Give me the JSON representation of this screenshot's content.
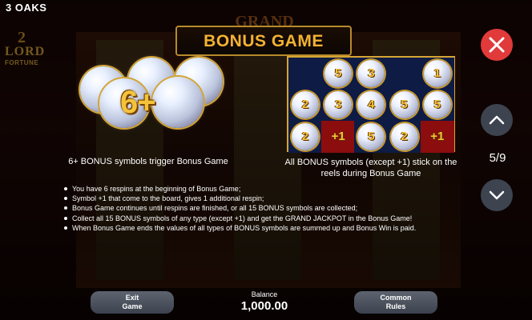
{
  "brand": "3 OAKS",
  "background": {
    "grand_label": "GRAND",
    "logo": {
      "number": "2",
      "line1": "LORD",
      "line2": "FORTUNE"
    }
  },
  "title": "BONUS GAME",
  "left_panel": {
    "badge": "6+",
    "caption": "6+ BONUS symbols trigger Bonus Game"
  },
  "right_panel": {
    "caption": "All BONUS symbols (except +1) stick on the reels during Bonus Game",
    "grid_rows": [
      [
        {
          "t": "blue",
          "v": ""
        },
        {
          "t": "pearl",
          "v": "5"
        },
        {
          "t": "pearl",
          "v": "3"
        },
        {
          "t": "blue",
          "v": ""
        },
        {
          "t": "pearl",
          "v": "1"
        }
      ],
      [
        {
          "t": "pearl",
          "v": "2"
        },
        {
          "t": "pearl",
          "v": "3"
        },
        {
          "t": "pearl",
          "v": "4"
        },
        {
          "t": "pearl",
          "v": "5"
        },
        {
          "t": "pearl",
          "v": "5"
        }
      ],
      [
        {
          "t": "pearl",
          "v": "2"
        },
        {
          "t": "red",
          "v": "+1"
        },
        {
          "t": "pearl",
          "v": "5"
        },
        {
          "t": "pearl",
          "v": "2"
        },
        {
          "t": "red",
          "v": "+1"
        }
      ]
    ]
  },
  "rules": [
    "You have 6 respins at the beginning of Bonus Game;",
    "Symbol +1 that come to the board, gives 1 additional respin;",
    "Bonus Game continues until respins are finished, or all 15 BONUS symbols are collected;",
    "Collect all 15 BONUS symbols of any type (except +1) and get the GRAND JACKPOT in the Bonus Game!",
    "When Bonus Game ends the values of all types of BONUS symbols are summed up and Bonus Win is paid."
  ],
  "controls": {
    "close_icon": "close-icon",
    "up_icon": "chevron-up-icon",
    "down_icon": "chevron-down-icon",
    "page_indicator": "5/9"
  },
  "bottom": {
    "exit_line1": "Exit",
    "exit_line2": "Game",
    "balance_label": "Balance",
    "balance_value": "1,000.00",
    "rules_line1": "Common",
    "rules_line2": "Rules"
  },
  "colors": {
    "accent_gold": "#f2b233",
    "close_red": "#e13a3a",
    "nav_gray": "#3d4450",
    "plus_one_red": "#8c0d0d"
  }
}
